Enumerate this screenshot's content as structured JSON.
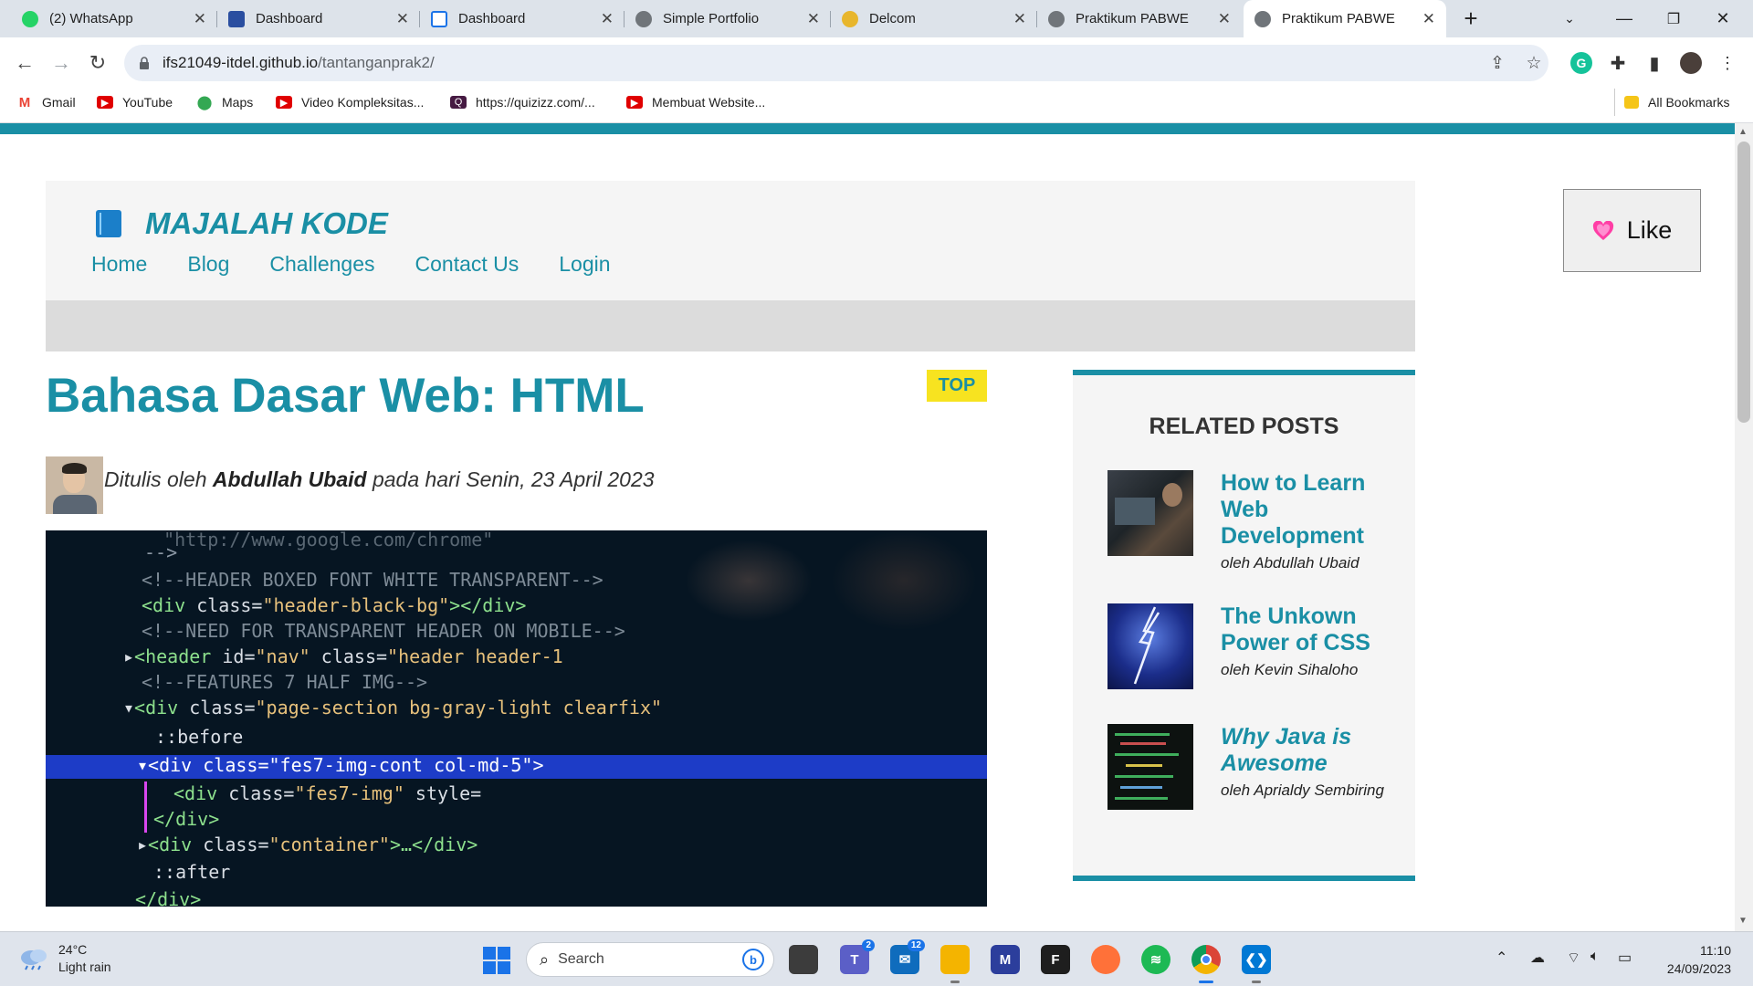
{
  "tabs": [
    {
      "title": "(2) WhatsApp",
      "icon": "whatsapp-icon",
      "color": "#25d366"
    },
    {
      "title": "Dashboard",
      "icon": "del-icon",
      "color": "#2a4ea0"
    },
    {
      "title": "Dashboard",
      "icon": "doc-icon",
      "color": "#1a73e8"
    },
    {
      "title": "Simple Portfolio",
      "icon": "globe-icon",
      "color": "#70757a"
    },
    {
      "title": "Delcom",
      "icon": "delcom-icon",
      "color": "#e8b62c"
    },
    {
      "title": "Praktikum PABWE",
      "icon": "globe-icon",
      "color": "#70757a"
    },
    {
      "title": "Praktikum PABWE",
      "icon": "globe-icon",
      "color": "#70757a"
    }
  ],
  "address": {
    "host": "ifs21049-itdel.github.io",
    "path": "/tantanganprak2/"
  },
  "bookmarks": [
    {
      "label": "Gmail",
      "icon": "gmail-icon",
      "color": "#ea4335"
    },
    {
      "label": "YouTube",
      "icon": "youtube-icon",
      "color": "#e00000"
    },
    {
      "label": "Maps",
      "icon": "maps-icon",
      "color": "#34a853"
    },
    {
      "label": "Video Kompleksitas...",
      "icon": "youtube-icon",
      "color": "#e00000"
    },
    {
      "label": "https://quizizz.com/...",
      "icon": "quizizz-icon",
      "color": "#461a42"
    },
    {
      "label": "Membuat Website...",
      "icon": "youtube-icon",
      "color": "#e00000"
    }
  ],
  "all_bookmarks": "All Bookmarks",
  "site": {
    "brand": "MAJALAH KODE",
    "nav": [
      "Home",
      "Blog",
      "Challenges",
      "Contact Us",
      "Login"
    ],
    "like_label": "Like",
    "accent": "#1a8fa5"
  },
  "article": {
    "title": "Bahasa Dasar Web: HTML",
    "badge": "TOP",
    "byline_prefix": "Ditulis oleh ",
    "author": "Abdullah Ubaid",
    "byline_suffix": " pada hari Senin, 23 April 2023"
  },
  "sidebar": {
    "heading": "RELATED POSTS",
    "posts": [
      {
        "title": "How to Learn Web Development",
        "author": "oleh Abdullah Ubaid"
      },
      {
        "title": "The Unkown Power of CSS",
        "author": "oleh Kevin Sihaloho"
      },
      {
        "title": "Why Java is Awesome",
        "author": "oleh Aprialdy Sembiring"
      }
    ]
  },
  "taskbar": {
    "weather_temp": "24°C",
    "weather_desc": "Light rain",
    "search_label": "Search",
    "time": "11:10",
    "date": "24/09/2023",
    "badges": {
      "teams": "2",
      "mail": "12"
    }
  }
}
